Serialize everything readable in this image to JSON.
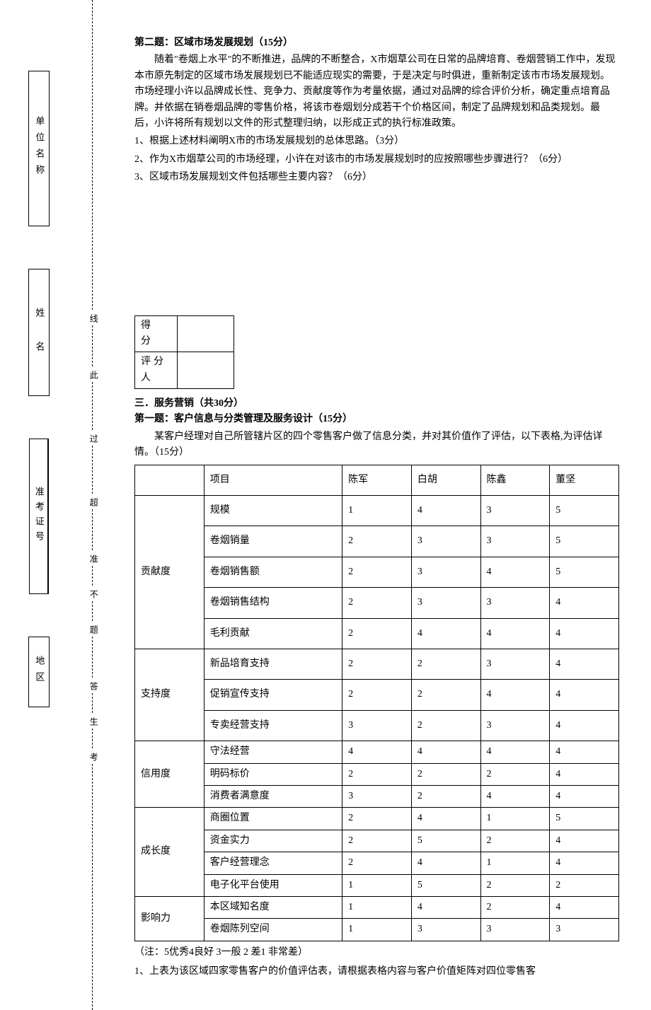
{
  "binding": {
    "labels": [
      "单位名称",
      "姓 名",
      "准考证号",
      "地区"
    ]
  },
  "dashed_text": "考 生 答 题 不 准 超 过 此 线",
  "q2": {
    "title": "第二题：区域市场发展规划（15分）",
    "para": "随着\"卷烟上水平\"的不断推进，品牌的不断整合，X市烟草公司在日常的品牌培育、卷烟营销工作中，发现本市原先制定的区域市场发展规划已不能适应现实的需要，于是决定与时俱进，重新制定该市市场发展规划。市场经理小许以品牌成长性、竞争力、贡献度等作为考量依据，通过对品牌的综合评价分析，确定重点培育品牌。并依据在销卷烟品牌的零售价格，将该市卷烟划分成若干个价格区间，制定了品牌规划和品类规划。最后，小许将所有规划以文件的形式整理归纳，以形成正式的执行标准政策。",
    "items": [
      "1、根据上述材料阐明X市的市场发展规划的总体思路。（3分）",
      "2、作为X市烟草公司的市场经理，小许在对该市的市场发展规划时的应按照哪些步骤进行？（6分）",
      "3、区域市场发展规划文件包括哪些主要内容？（6分）"
    ]
  },
  "score": {
    "row1": "得 分",
    "row2": "评分人"
  },
  "section3": {
    "heading": "三．服务营销（共30分）",
    "q1_title": "第一题：客户信息与分类管理及服务设计（15分）",
    "q1_para": "某客户经理对自己所管辖片区的四个零售客户做了信息分类，并对其价值作了评估，以下表格,为评估详情。（15分）"
  },
  "table": {
    "headers": [
      "",
      "项目",
      "陈军",
      "白胡",
      "陈鑫",
      "董坚"
    ],
    "groups": [
      {
        "category": "贡献度",
        "tall": true,
        "rows": [
          {
            "item": "规模",
            "vals": [
              "1",
              "4",
              "3",
              "5"
            ]
          },
          {
            "item": "卷烟销量",
            "vals": [
              "2",
              "3",
              "3",
              "5"
            ]
          },
          {
            "item": "卷烟销售额",
            "vals": [
              "2",
              "3",
              "4",
              "5"
            ]
          },
          {
            "item": "卷烟销售结构",
            "vals": [
              "2",
              "3",
              "3",
              "4"
            ]
          },
          {
            "item": "毛利贡献",
            "vals": [
              "2",
              "4",
              "4",
              "4"
            ]
          }
        ]
      },
      {
        "category": "支持度",
        "tall": true,
        "rows": [
          {
            "item": "新品培育支持",
            "vals": [
              "2",
              "2",
              "3",
              "4"
            ]
          },
          {
            "item": "促销宣传支持",
            "vals": [
              "2",
              "2",
              "4",
              "4"
            ]
          },
          {
            "item": "专卖经营支持",
            "vals": [
              "3",
              "2",
              "3",
              "4"
            ]
          }
        ]
      },
      {
        "category": "信用度",
        "rows": [
          {
            "item": "守法经营",
            "vals": [
              "4",
              "4",
              "4",
              "4"
            ]
          },
          {
            "item": "明码标价",
            "vals": [
              "2",
              "2",
              "2",
              "4"
            ]
          },
          {
            "item": "消费者满意度",
            "vals": [
              "3",
              "2",
              "4",
              "4"
            ]
          }
        ]
      },
      {
        "category": "成长度",
        "rows": [
          {
            "item": "商圈位置",
            "vals": [
              "2",
              "4",
              "1",
              "5"
            ]
          },
          {
            "item": "资金实力",
            "vals": [
              "2",
              "5",
              "2",
              "4"
            ]
          },
          {
            "item": "客户经营理念",
            "vals": [
              "2",
              "4",
              "1",
              "4"
            ]
          },
          {
            "item": "电子化平台使用",
            "vals": [
              "1",
              "5",
              "2",
              "2"
            ]
          }
        ]
      },
      {
        "category": "影响力",
        "rows": [
          {
            "item": "本区域知名度",
            "vals": [
              "1",
              "4",
              "2",
              "4"
            ]
          },
          {
            "item": "卷烟陈列空间",
            "vals": [
              "1",
              "3",
              "3",
              "3"
            ]
          }
        ]
      }
    ]
  },
  "note": "（注：5优秀4良好 3一般 2 差1 非常差）",
  "follow": "1、上表为该区域四家零售客户的价值评估表，请根据表格内容与客户价值矩阵对四位零售客"
}
